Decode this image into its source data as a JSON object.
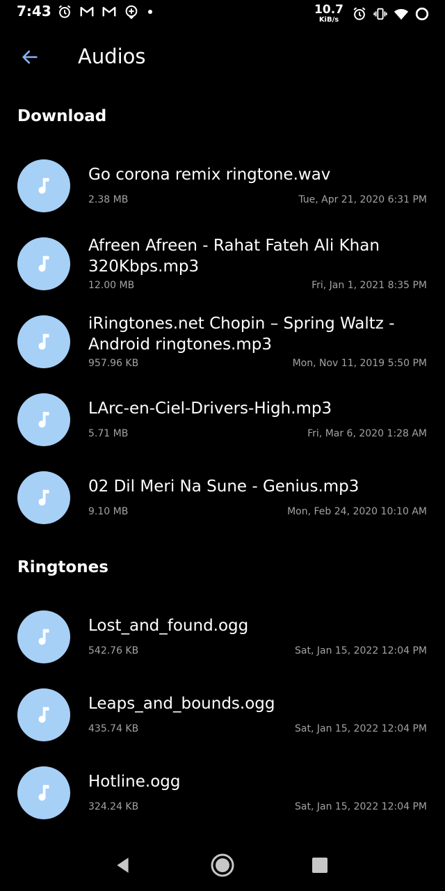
{
  "status_bar": {
    "time": "7:43",
    "net_speed_value": "10.7",
    "net_speed_unit": "KiB/s",
    "left_icons": [
      "alarm-icon",
      "gmail-icon",
      "gmail-icon",
      "add-circle-icon",
      "dot-icon"
    ],
    "right_icons": [
      "alarm-icon",
      "vibrate-icon",
      "wifi-icon",
      "loading-icon"
    ]
  },
  "app_bar": {
    "title": "Audios",
    "back_icon": "arrow-back-icon"
  },
  "colors": {
    "background": "#000000",
    "accent": "#8ab4f8",
    "avatar": "#a7d0f7",
    "text_primary": "#ffffff",
    "text_secondary": "#a3a3a3"
  },
  "sections": [
    {
      "title": "Download",
      "items": [
        {
          "name": "Go corona remix ringtone.wav",
          "size": "2.38 MB",
          "date": "Tue, Apr 21, 2020 6:31 PM"
        },
        {
          "name": "Afreen Afreen - Rahat Fateh Ali Khan 320Kbps.mp3",
          "size": "12.00 MB",
          "date": "Fri, Jan 1, 2021 8:35 PM"
        },
        {
          "name": "iRingtones.net Chopin – Spring Waltz - Android ringtones.mp3",
          "size": "957.96 KB",
          "date": "Mon, Nov 11, 2019 5:50 PM"
        },
        {
          "name": "LArc-en-Ciel-Drivers-High.mp3",
          "size": "5.71 MB",
          "date": "Fri, Mar 6, 2020 1:28 AM"
        },
        {
          "name": "02 Dil Meri Na Sune - Genius.mp3",
          "size": "9.10 MB",
          "date": "Mon, Feb 24, 2020 10:10 AM"
        }
      ]
    },
    {
      "title": "Ringtones",
      "items": [
        {
          "name": "Lost_and_found.ogg",
          "size": "542.76 KB",
          "date": "Sat, Jan 15, 2022 12:04 PM"
        },
        {
          "name": "Leaps_and_bounds.ogg",
          "size": "435.74 KB",
          "date": "Sat, Jan 15, 2022 12:04 PM"
        },
        {
          "name": "Hotline.ogg",
          "size": "324.24 KB",
          "date": "Sat, Jan 15, 2022 12:04 PM"
        }
      ]
    }
  ],
  "nav_bar": {
    "buttons": [
      "back-triangle-icon",
      "home-circle-icon",
      "recents-square-icon"
    ]
  }
}
